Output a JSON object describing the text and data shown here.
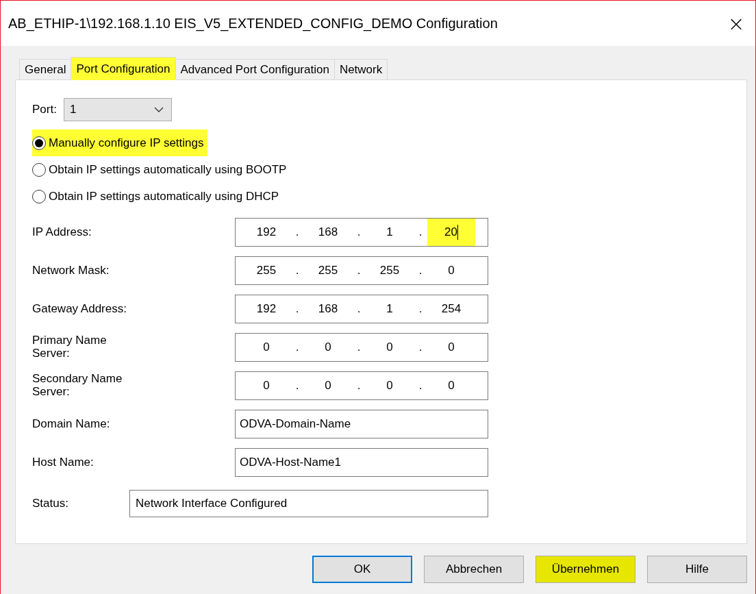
{
  "window": {
    "title": "AB_ETHIP-1\\192.168.1.10 EIS_V5_EXTENDED_CONFIG_DEMO Configuration",
    "close": "×"
  },
  "tabs": [
    {
      "label": "General",
      "selected": false,
      "highlighted": false
    },
    {
      "label": "Port Configuration",
      "selected": true,
      "highlighted": true
    },
    {
      "label": "Advanced Port Configuration",
      "selected": false,
      "highlighted": false
    },
    {
      "label": "Network",
      "selected": false,
      "highlighted": false
    }
  ],
  "port": {
    "label": "Port:",
    "value": "1"
  },
  "radios": [
    {
      "label": "Manually configure IP settings",
      "selected": true,
      "highlighted": true
    },
    {
      "label": "Obtain IP settings automatically using BOOTP",
      "selected": false,
      "highlighted": false
    },
    {
      "label": "Obtain IP settings automatically using DHCP",
      "selected": false,
      "highlighted": false
    }
  ],
  "fields": [
    {
      "kind": "ip",
      "label": "IP Address:",
      "separator": ".",
      "octets": [
        {
          "value": "192",
          "highlighted": false,
          "caret": false
        },
        {
          "value": "168",
          "highlighted": false,
          "caret": false
        },
        {
          "value": "1",
          "highlighted": false,
          "caret": false
        },
        {
          "value": "20",
          "highlighted": true,
          "caret": true
        }
      ]
    },
    {
      "kind": "ip",
      "label": "Network Mask:",
      "separator": ".",
      "octets": [
        {
          "value": "255",
          "highlighted": false,
          "caret": false
        },
        {
          "value": "255",
          "highlighted": false,
          "caret": false
        },
        {
          "value": "255",
          "highlighted": false,
          "caret": false
        },
        {
          "value": "0",
          "highlighted": false,
          "caret": false
        }
      ]
    },
    {
      "kind": "ip",
      "label": "Gateway Address:",
      "separator": ".",
      "octets": [
        {
          "value": "192",
          "highlighted": false,
          "caret": false
        },
        {
          "value": "168",
          "highlighted": false,
          "caret": false
        },
        {
          "value": "1",
          "highlighted": false,
          "caret": false
        },
        {
          "value": "254",
          "highlighted": false,
          "caret": false
        }
      ]
    },
    {
      "kind": "ip",
      "label": "Primary Name\nServer:",
      "separator": ".",
      "octets": [
        {
          "value": "0",
          "highlighted": false,
          "caret": false
        },
        {
          "value": "0",
          "highlighted": false,
          "caret": false
        },
        {
          "value": "0",
          "highlighted": false,
          "caret": false
        },
        {
          "value": "0",
          "highlighted": false,
          "caret": false
        }
      ]
    },
    {
      "kind": "ip",
      "label": "Secondary Name\nServer:",
      "separator": ".",
      "octets": [
        {
          "value": "0",
          "highlighted": false,
          "caret": false
        },
        {
          "value": "0",
          "highlighted": false,
          "caret": false
        },
        {
          "value": "0",
          "highlighted": false,
          "caret": false
        },
        {
          "value": "0",
          "highlighted": false,
          "caret": false
        }
      ]
    },
    {
      "kind": "text",
      "label": "Domain Name:",
      "value": "ODVA-Domain-Name"
    },
    {
      "kind": "text",
      "label": "Host Name:",
      "value": "ODVA-Host-Name1"
    }
  ],
  "status": {
    "label": "Status:",
    "value": "Network Interface Configured"
  },
  "buttons": [
    {
      "label": "OK",
      "default": true,
      "highlighted": false
    },
    {
      "label": "Abbrechen",
      "default": false,
      "highlighted": false
    },
    {
      "label": "Übernehmen",
      "default": false,
      "highlighted": true
    },
    {
      "label": "Hilfe",
      "default": false,
      "highlighted": false
    }
  ]
}
